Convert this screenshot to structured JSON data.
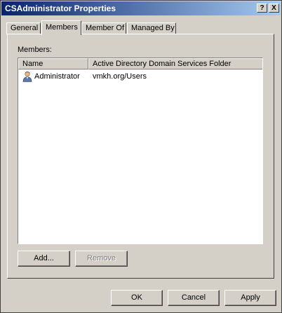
{
  "window": {
    "title": "CSAdministrator Properties",
    "help_glyph": "?",
    "close_glyph": "X"
  },
  "tabs": [
    {
      "label": "General",
      "selected": false
    },
    {
      "label": "Members",
      "selected": true
    },
    {
      "label": "Member Of",
      "selected": false
    },
    {
      "label": "Managed By",
      "selected": false
    }
  ],
  "members": {
    "label": "Members:",
    "columns": [
      "Name",
      "Active Directory Domain Services Folder"
    ],
    "rows": [
      {
        "name": "Administrator",
        "folder": "vmkh.org/Users",
        "icon": "user-icon"
      }
    ],
    "add_label": "Add...",
    "remove_label": "Remove"
  },
  "footer": {
    "ok_label": "OK",
    "cancel_label": "Cancel",
    "apply_label": "Apply"
  },
  "colors": {
    "title_bar": "#0a246a",
    "face": "#d4d0c8"
  }
}
